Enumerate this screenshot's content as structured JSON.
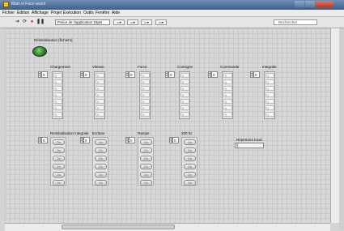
{
  "window": {
    "title": "Main.vi Face-avant",
    "controls": [
      "minimize",
      "maximize",
      "close"
    ]
  },
  "menu": [
    "Fichier",
    "Edition",
    "Affichage",
    "Projet",
    "Exécution",
    "Outils",
    "Fenêtre",
    "Aide"
  ],
  "toolbar": {
    "icons": [
      "run-arrow-icon",
      "run-continuous-icon",
      "abort-icon",
      "pause-icon"
    ],
    "font": "Police de l'application 15pts",
    "search_placeholder": "Rechercher"
  },
  "front_panel": {
    "button": {
      "label": "Réinitialisation (fichiers)",
      "state": "on",
      "color": "#3aa83a"
    },
    "arrays_top": [
      {
        "label": "Chargement",
        "index": "0",
        "cells": [
          "0",
          "0",
          "0",
          "0",
          "0",
          "0",
          "0"
        ]
      },
      {
        "label": "Vitesse",
        "index": "0",
        "cells": [
          "0",
          "0",
          "0",
          "0",
          "0",
          "0",
          "0"
        ]
      },
      {
        "label": "Force",
        "index": "0",
        "cells": [
          "0",
          "0",
          "0",
          "0",
          "0",
          "0",
          "0"
        ]
      },
      {
        "label": "Consigne",
        "index": "0",
        "cells": [
          "0",
          "0",
          "0",
          "0",
          "0",
          "0",
          "0"
        ]
      },
      {
        "label": "Commande",
        "index": "0",
        "cells": [
          "0",
          "0",
          "0",
          "0",
          "0",
          "0",
          "0"
        ]
      },
      {
        "label": "Integrale",
        "index": "0",
        "cells": [
          "0",
          "0",
          "0",
          "0",
          "0",
          "0",
          "0"
        ]
      }
    ],
    "arrays_bottom": [
      {
        "label": "Reinitialisation integrale",
        "index": "0",
        "buttons": [
          "On",
          "On",
          "On",
          "On",
          "On",
          "On"
        ]
      },
      {
        "label": "Ecriture",
        "index": "0",
        "buttons": [
          "On",
          "On",
          "On",
          "On",
          "On",
          "On"
        ]
      },
      {
        "label": "Rampe",
        "index": "0",
        "buttons": [
          "On",
          "On",
          "On",
          "On",
          "On",
          "On"
        ]
      },
      {
        "label": "200 hz",
        "index": "0",
        "buttons": [
          "On",
          "On",
          "On",
          "On",
          "On",
          "On"
        ]
      }
    ],
    "path": {
      "label": "Répertoire local",
      "value": "§"
    }
  }
}
